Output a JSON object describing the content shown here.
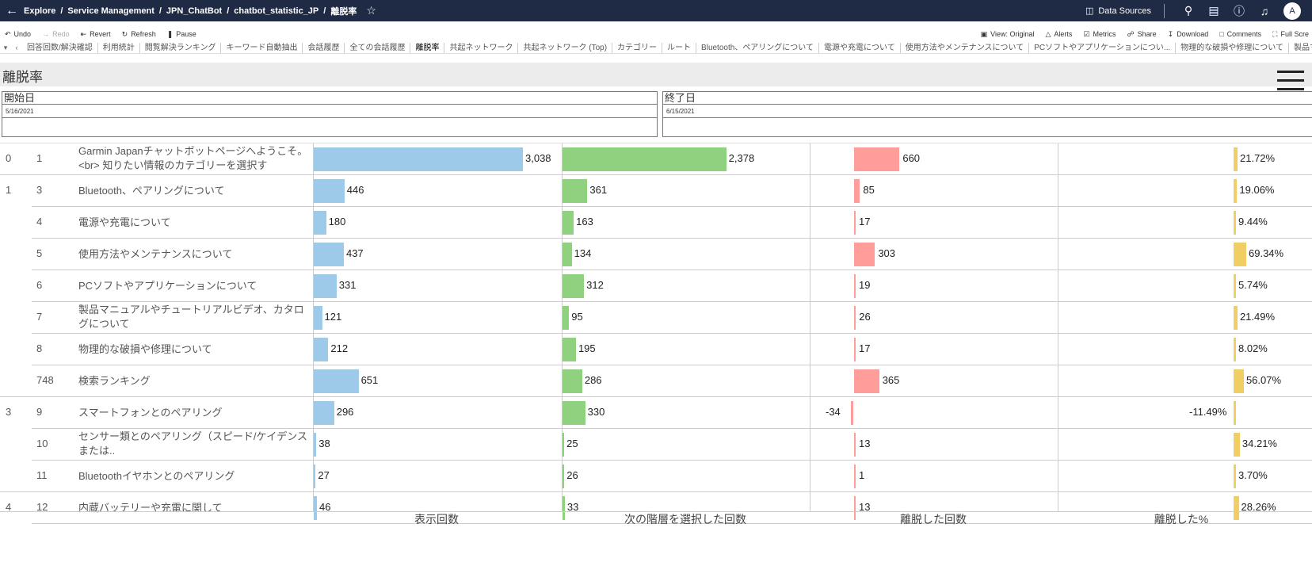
{
  "topbar": {
    "crumbs": [
      "Explore",
      "Service Management",
      "JPN_ChatBot",
      "chatbot_statistic_JP",
      "離脱率"
    ],
    "data_sources": "Data Sources",
    "avatar": "A"
  },
  "toolbar": {
    "left": [
      "Undo",
      "Redo",
      "Revert",
      "Refresh",
      "Pause"
    ],
    "right": [
      "View: Original",
      "Alerts",
      "Metrics",
      "Share",
      "Download",
      "Comments",
      "Full Scre"
    ]
  },
  "tabs": [
    "回答回数/解決確認",
    "利用統計",
    "閲覧解決ランキング",
    "キーワード自動抽出",
    "会話履歴",
    "全ての会話履歴",
    "離脱率",
    "共起ネットワーク",
    "共起ネットワーク (Top)",
    "カテゴリー",
    "ルート",
    "Bluetooth、ペアリングについて",
    "電源や充電について",
    "使用方法やメンテナンスについて",
    "PCソフトやアプリケーションについ...",
    "物理的な破損や修理について",
    "製品マニ"
  ],
  "active_tab": "離脱率",
  "dashboard_title": "離脱率",
  "filters": {
    "start_label": "開始日",
    "start_value": "5/16/2021",
    "end_label": "終了日",
    "end_value": "6/15/2021"
  },
  "colors": {
    "views": "#9ecae9",
    "next": "#8fd17f",
    "dropped": "#ff9d9a",
    "pct": "#f1ce63"
  },
  "column_headers": [
    "表示回数",
    "次の階層を選択した回数",
    "離脱した回数",
    "離脱した%"
  ],
  "rows": [
    {
      "level": "0",
      "id": "1",
      "category": "Garmin Japanチャットボットページへようこそ。<br> 知りたい情報のカテゴリーを選択す",
      "views": 3038,
      "views_label": "3,038",
      "next": 2378,
      "next_label": "2,378",
      "dropped": 660,
      "dropped_label": "660",
      "pct": 21.72,
      "pct_label": "21.72%"
    },
    {
      "level": "1",
      "id": "3",
      "category": "Bluetooth、ペアリングについて",
      "views": 446,
      "views_label": "446",
      "next": 361,
      "next_label": "361",
      "dropped": 85,
      "dropped_label": "85",
      "pct": 19.06,
      "pct_label": "19.06%"
    },
    {
      "level": "",
      "id": "4",
      "category": "電源や充電について",
      "views": 180,
      "views_label": "180",
      "next": 163,
      "next_label": "163",
      "dropped": 17,
      "dropped_label": "17",
      "pct": 9.44,
      "pct_label": "9.44%"
    },
    {
      "level": "",
      "id": "5",
      "category": "使用方法やメンテナンスについて",
      "views": 437,
      "views_label": "437",
      "next": 134,
      "next_label": "134",
      "dropped": 303,
      "dropped_label": "303",
      "pct": 69.34,
      "pct_label": "69.34%"
    },
    {
      "level": "",
      "id": "6",
      "category": "PCソフトやアプリケーションについて",
      "views": 331,
      "views_label": "331",
      "next": 312,
      "next_label": "312",
      "dropped": 19,
      "dropped_label": "19",
      "pct": 5.74,
      "pct_label": "5.74%"
    },
    {
      "level": "",
      "id": "7",
      "category": "製品マニュアルやチュートリアルビデオ、カタログについて",
      "views": 121,
      "views_label": "121",
      "next": 95,
      "next_label": "95",
      "dropped": 26,
      "dropped_label": "26",
      "pct": 21.49,
      "pct_label": "21.49%"
    },
    {
      "level": "",
      "id": "8",
      "category": "物理的な破損や修理について",
      "views": 212,
      "views_label": "212",
      "next": 195,
      "next_label": "195",
      "dropped": 17,
      "dropped_label": "17",
      "pct": 8.02,
      "pct_label": "8.02%"
    },
    {
      "level": "",
      "id": "748",
      "category": "検索ランキング",
      "views": 651,
      "views_label": "651",
      "next": 286,
      "next_label": "286",
      "dropped": 365,
      "dropped_label": "365",
      "pct": 56.07,
      "pct_label": "56.07%"
    },
    {
      "level": "3",
      "id": "9",
      "category": "スマートフォンとのペアリング",
      "views": 296,
      "views_label": "296",
      "next": 330,
      "next_label": "330",
      "dropped": -34,
      "dropped_label": "-34",
      "pct": -11.49,
      "pct_label": "-11.49%"
    },
    {
      "level": "",
      "id": "10",
      "category": "センサー類とのペアリング（スピード/ケイデンスまたは..",
      "views": 38,
      "views_label": "38",
      "next": 25,
      "next_label": "25",
      "dropped": 13,
      "dropped_label": "13",
      "pct": 34.21,
      "pct_label": "34.21%"
    },
    {
      "level": "",
      "id": "11",
      "category": "Bluetoothイヤホンとのペアリング",
      "views": 27,
      "views_label": "27",
      "next": 26,
      "next_label": "26",
      "dropped": 1,
      "dropped_label": "1",
      "pct": 3.7,
      "pct_label": "3.70%"
    },
    {
      "level": "4",
      "id": "12",
      "category": "内蔵バッテリーや充電に関して",
      "views": 46,
      "views_label": "46",
      "next": 33,
      "next_label": "33",
      "dropped": 13,
      "dropped_label": "13",
      "pct": 28.26,
      "pct_label": "28.26%"
    }
  ],
  "chart_data": {
    "type": "bar",
    "categories": [
      "1",
      "3",
      "4",
      "5",
      "6",
      "7",
      "8",
      "748",
      "9",
      "10",
      "11",
      "12"
    ],
    "series": [
      {
        "name": "表示回数",
        "values": [
          3038,
          446,
          180,
          437,
          331,
          121,
          212,
          651,
          296,
          38,
          27,
          46
        ]
      },
      {
        "name": "次の階層を選択した回数",
        "values": [
          2378,
          361,
          163,
          134,
          312,
          95,
          195,
          286,
          330,
          25,
          26,
          33
        ]
      },
      {
        "name": "離脱した回数",
        "values": [
          660,
          85,
          17,
          303,
          19,
          26,
          17,
          365,
          -34,
          13,
          1,
          13
        ]
      },
      {
        "name": "離脱した%",
        "values": [
          21.72,
          19.06,
          9.44,
          69.34,
          5.74,
          21.49,
          8.02,
          56.07,
          -11.49,
          34.21,
          3.7,
          28.26
        ]
      }
    ]
  }
}
